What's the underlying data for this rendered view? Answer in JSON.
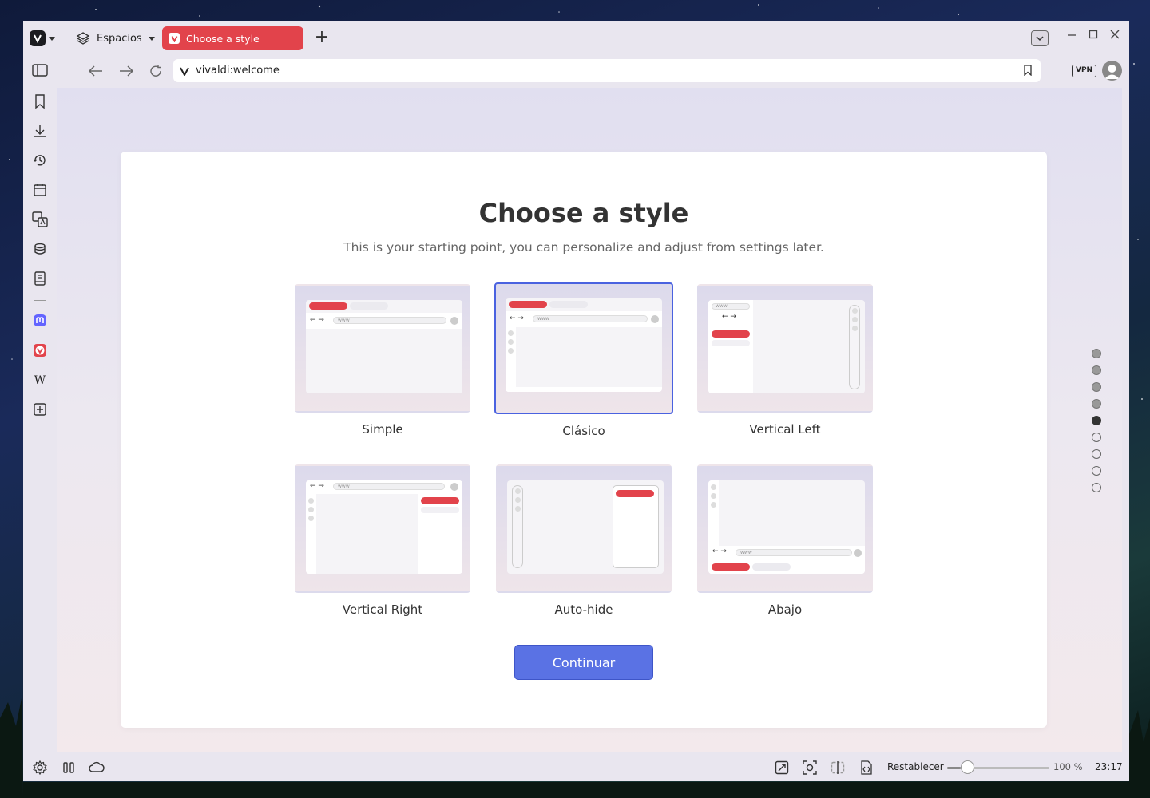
{
  "tabs": {
    "spaces_label": "Espacios",
    "active_tab_title": "Choose a style"
  },
  "address": {
    "url": "vivaldi:welcome",
    "vpn_label": "VPN"
  },
  "sidebar": {
    "items": [
      "bookmarks-icon",
      "downloads-icon",
      "history-icon",
      "calendar-icon",
      "translate-icon",
      "reading-list-icon",
      "notes-icon",
      "mastodon-icon",
      "vivaldi-icon",
      "wikipedia-icon",
      "add-panel-icon"
    ]
  },
  "page": {
    "title": "Choose a style",
    "subtitle": "This is your starting point, you can personalize and adjust from settings later.",
    "options": [
      {
        "label": "Simple",
        "selected": false
      },
      {
        "label": "Clásico",
        "selected": true
      },
      {
        "label": "Vertical Left",
        "selected": false
      },
      {
        "label": "Vertical Right",
        "selected": false
      },
      {
        "label": "Auto-hide",
        "selected": false
      },
      {
        "label": "Abajo",
        "selected": false
      }
    ],
    "continue_label": "Continuar",
    "progress": {
      "total": 9,
      "current": 5
    }
  },
  "statusbar": {
    "reset_label": "Restablecer",
    "zoom": "100 %",
    "zoom_fraction": 0.2,
    "clock": "23:17"
  },
  "colors": {
    "accent": "#5a72e4",
    "tab_active": "#e2434b",
    "selected_border": "#4a62e0"
  }
}
